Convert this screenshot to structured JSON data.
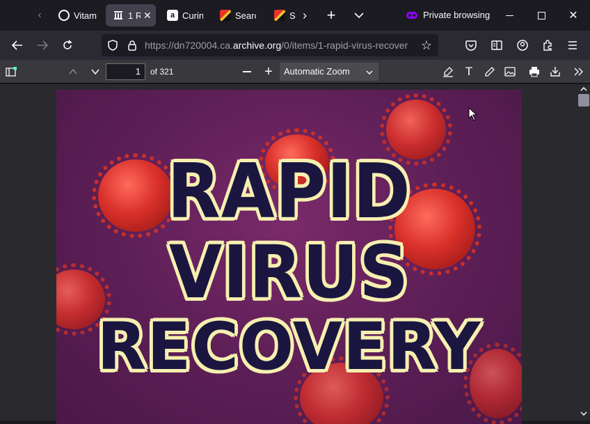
{
  "tabs": [
    {
      "title": "Vitam",
      "icon": "ring-icon"
    },
    {
      "title": "1 R",
      "icon": "archive-icon",
      "active": true
    },
    {
      "title": "Curin",
      "icon": "amazon-icon"
    },
    {
      "title": "Searc",
      "icon": "search-engine-icon"
    },
    {
      "title": "Se",
      "icon": "search-engine-icon"
    }
  ],
  "private_label": "Private browsing",
  "url": {
    "prefix": "https://dn720004.ca.",
    "domain": "archive.org",
    "suffix": "/0/items/1-rapid-virus-recover"
  },
  "pdf": {
    "page_number": "1",
    "page_count": "of 321",
    "zoom": "Automatic Zoom"
  },
  "document": {
    "title_lines": [
      "RAPID",
      "VIRUS",
      "RECOVERY"
    ]
  },
  "colors": {
    "accent_private": "#8f00ff",
    "title_fill": "#1b1640",
    "title_outline": "#f6f0b0",
    "cover_bg": "#5e1f57"
  }
}
